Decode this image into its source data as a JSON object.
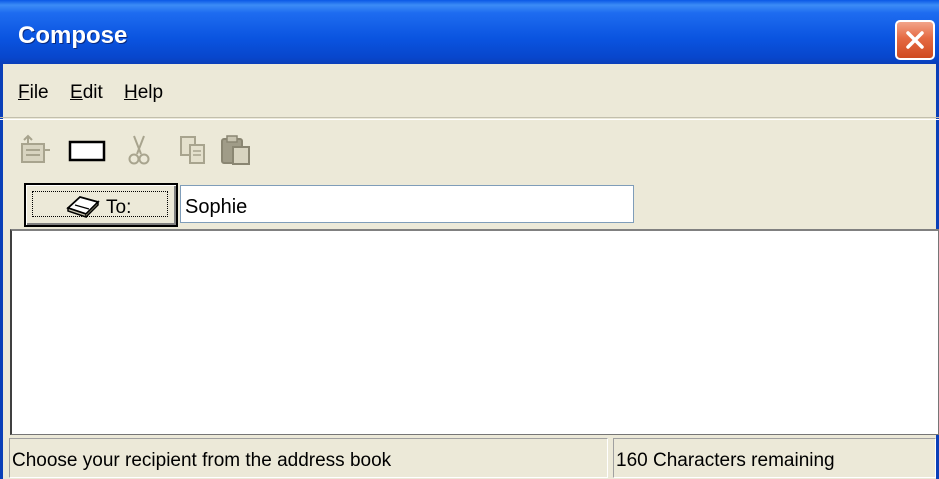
{
  "window": {
    "title": "Compose"
  },
  "menu": {
    "file": "File",
    "edit": "Edit",
    "help": "Help"
  },
  "toolbar": {
    "icons": [
      "send-icon",
      "blank-icon",
      "cut-icon",
      "copy-icon",
      "paste-icon"
    ]
  },
  "to": {
    "button_label": "To:",
    "value": "Sophie"
  },
  "message": {
    "value": ""
  },
  "status": {
    "hint": "Choose your recipient from the address book",
    "remaining": "160 Characters remaining"
  },
  "colors": {
    "title_bar": "#0a54e0",
    "window_bg": "#ece9d8",
    "close_button": "#e56a43"
  }
}
